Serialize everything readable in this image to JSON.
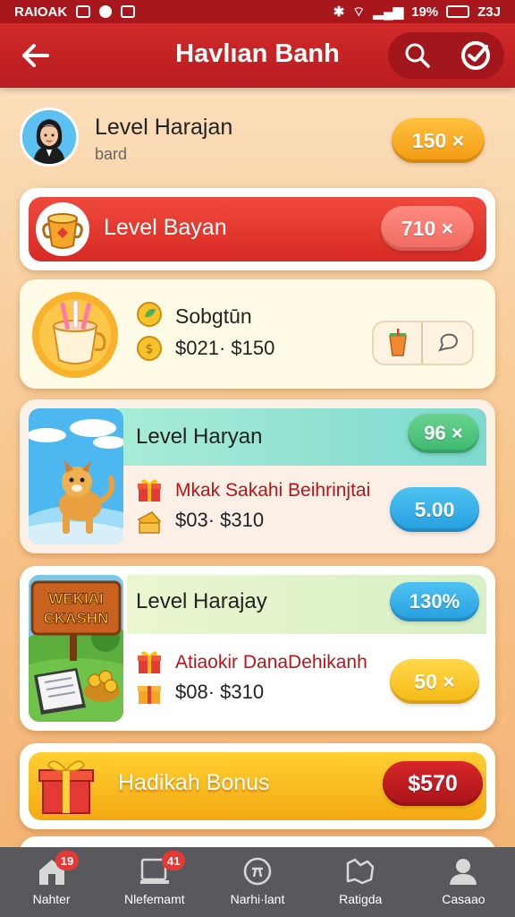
{
  "status_bar": {
    "left_text": "RAIOAK",
    "battery_text": "19%",
    "time": "Z3J"
  },
  "app_bar": {
    "title": "Havlıan Banh",
    "back_icon": "arrow-left-icon",
    "search_icon": "search-icon",
    "check_icon": "check-circle-icon"
  },
  "user": {
    "name": "Level Harajan",
    "subtitle": "bard",
    "coins": "150 ×"
  },
  "cards": [
    {
      "label": "Level Bayan",
      "value": "710 ×"
    },
    {
      "title": "Sobgtūn",
      "line": "$021· $150"
    },
    {
      "title": "Level Haryan",
      "badge": "96 ×",
      "subline": "Mkak Sakahi Beihrinjtai",
      "line": "$03· $310",
      "value": "5.00"
    },
    {
      "title": "Level Harajay",
      "badge": "130%",
      "sign_text_1": "WEKIAI",
      "sign_text_2": "CKASHN",
      "subline": "Atiaokir DanaDehikanh",
      "line": "$08· $310",
      "value": "50 ×"
    },
    {
      "label": "Hadikah Bonus",
      "value": "$570"
    }
  ],
  "bottom_nav": [
    {
      "label": "Nahter",
      "badge": "19",
      "icon": "home-icon"
    },
    {
      "label": "Nlefemamt",
      "badge": "41",
      "icon": "tablet-icon"
    },
    {
      "label": "Narhi·lant",
      "badge": "",
      "icon": "compass-icon"
    },
    {
      "label": "Ratigda",
      "badge": "",
      "icon": "map-icon"
    },
    {
      "label": "Casaao",
      "badge": "",
      "icon": "profile-icon"
    }
  ],
  "colors": {
    "primary_red": "#c8202a",
    "background": "#f7c48a",
    "nav_bg": "#57595d"
  }
}
